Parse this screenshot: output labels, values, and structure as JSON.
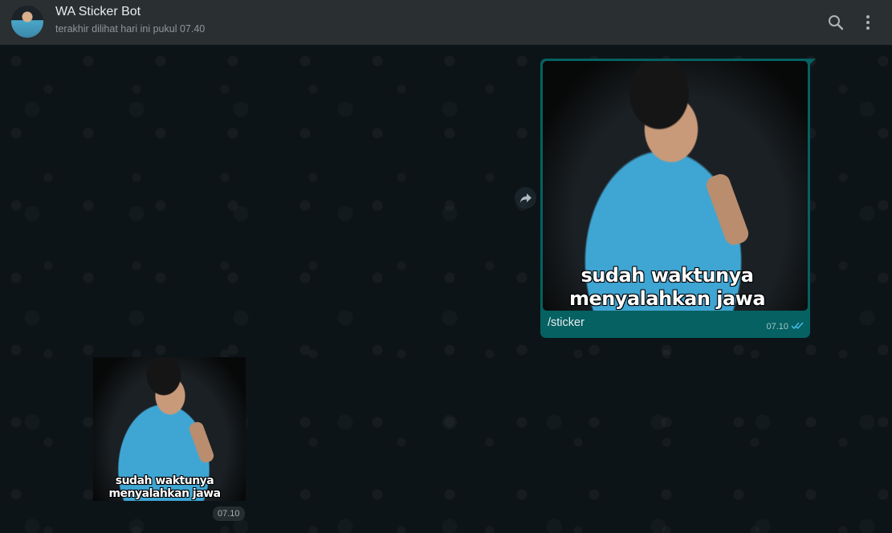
{
  "header": {
    "title": "WA Sticker Bot",
    "subtitle": "terakhir dilihat hari ini pukul 07.40",
    "icons": [
      "search-icon",
      "menu-icon"
    ]
  },
  "messages": [
    {
      "direction": "outgoing",
      "type": "image",
      "image_text_line1": "sudah waktunya",
      "image_text_line2": "menyalahkan  jawa",
      "caption": "/sticker",
      "time": "07.10",
      "status": "read-double-check"
    },
    {
      "direction": "incoming",
      "type": "sticker",
      "image_text_line1": "sudah waktunya",
      "image_text_line2": "menyalahkan  jawa",
      "time": "07.10"
    }
  ],
  "colors": {
    "header_bg": "#2a2f32",
    "chat_bg": "#0d1418",
    "outgoing_bubble": "#056162",
    "read_tick": "#4fc3f7"
  }
}
